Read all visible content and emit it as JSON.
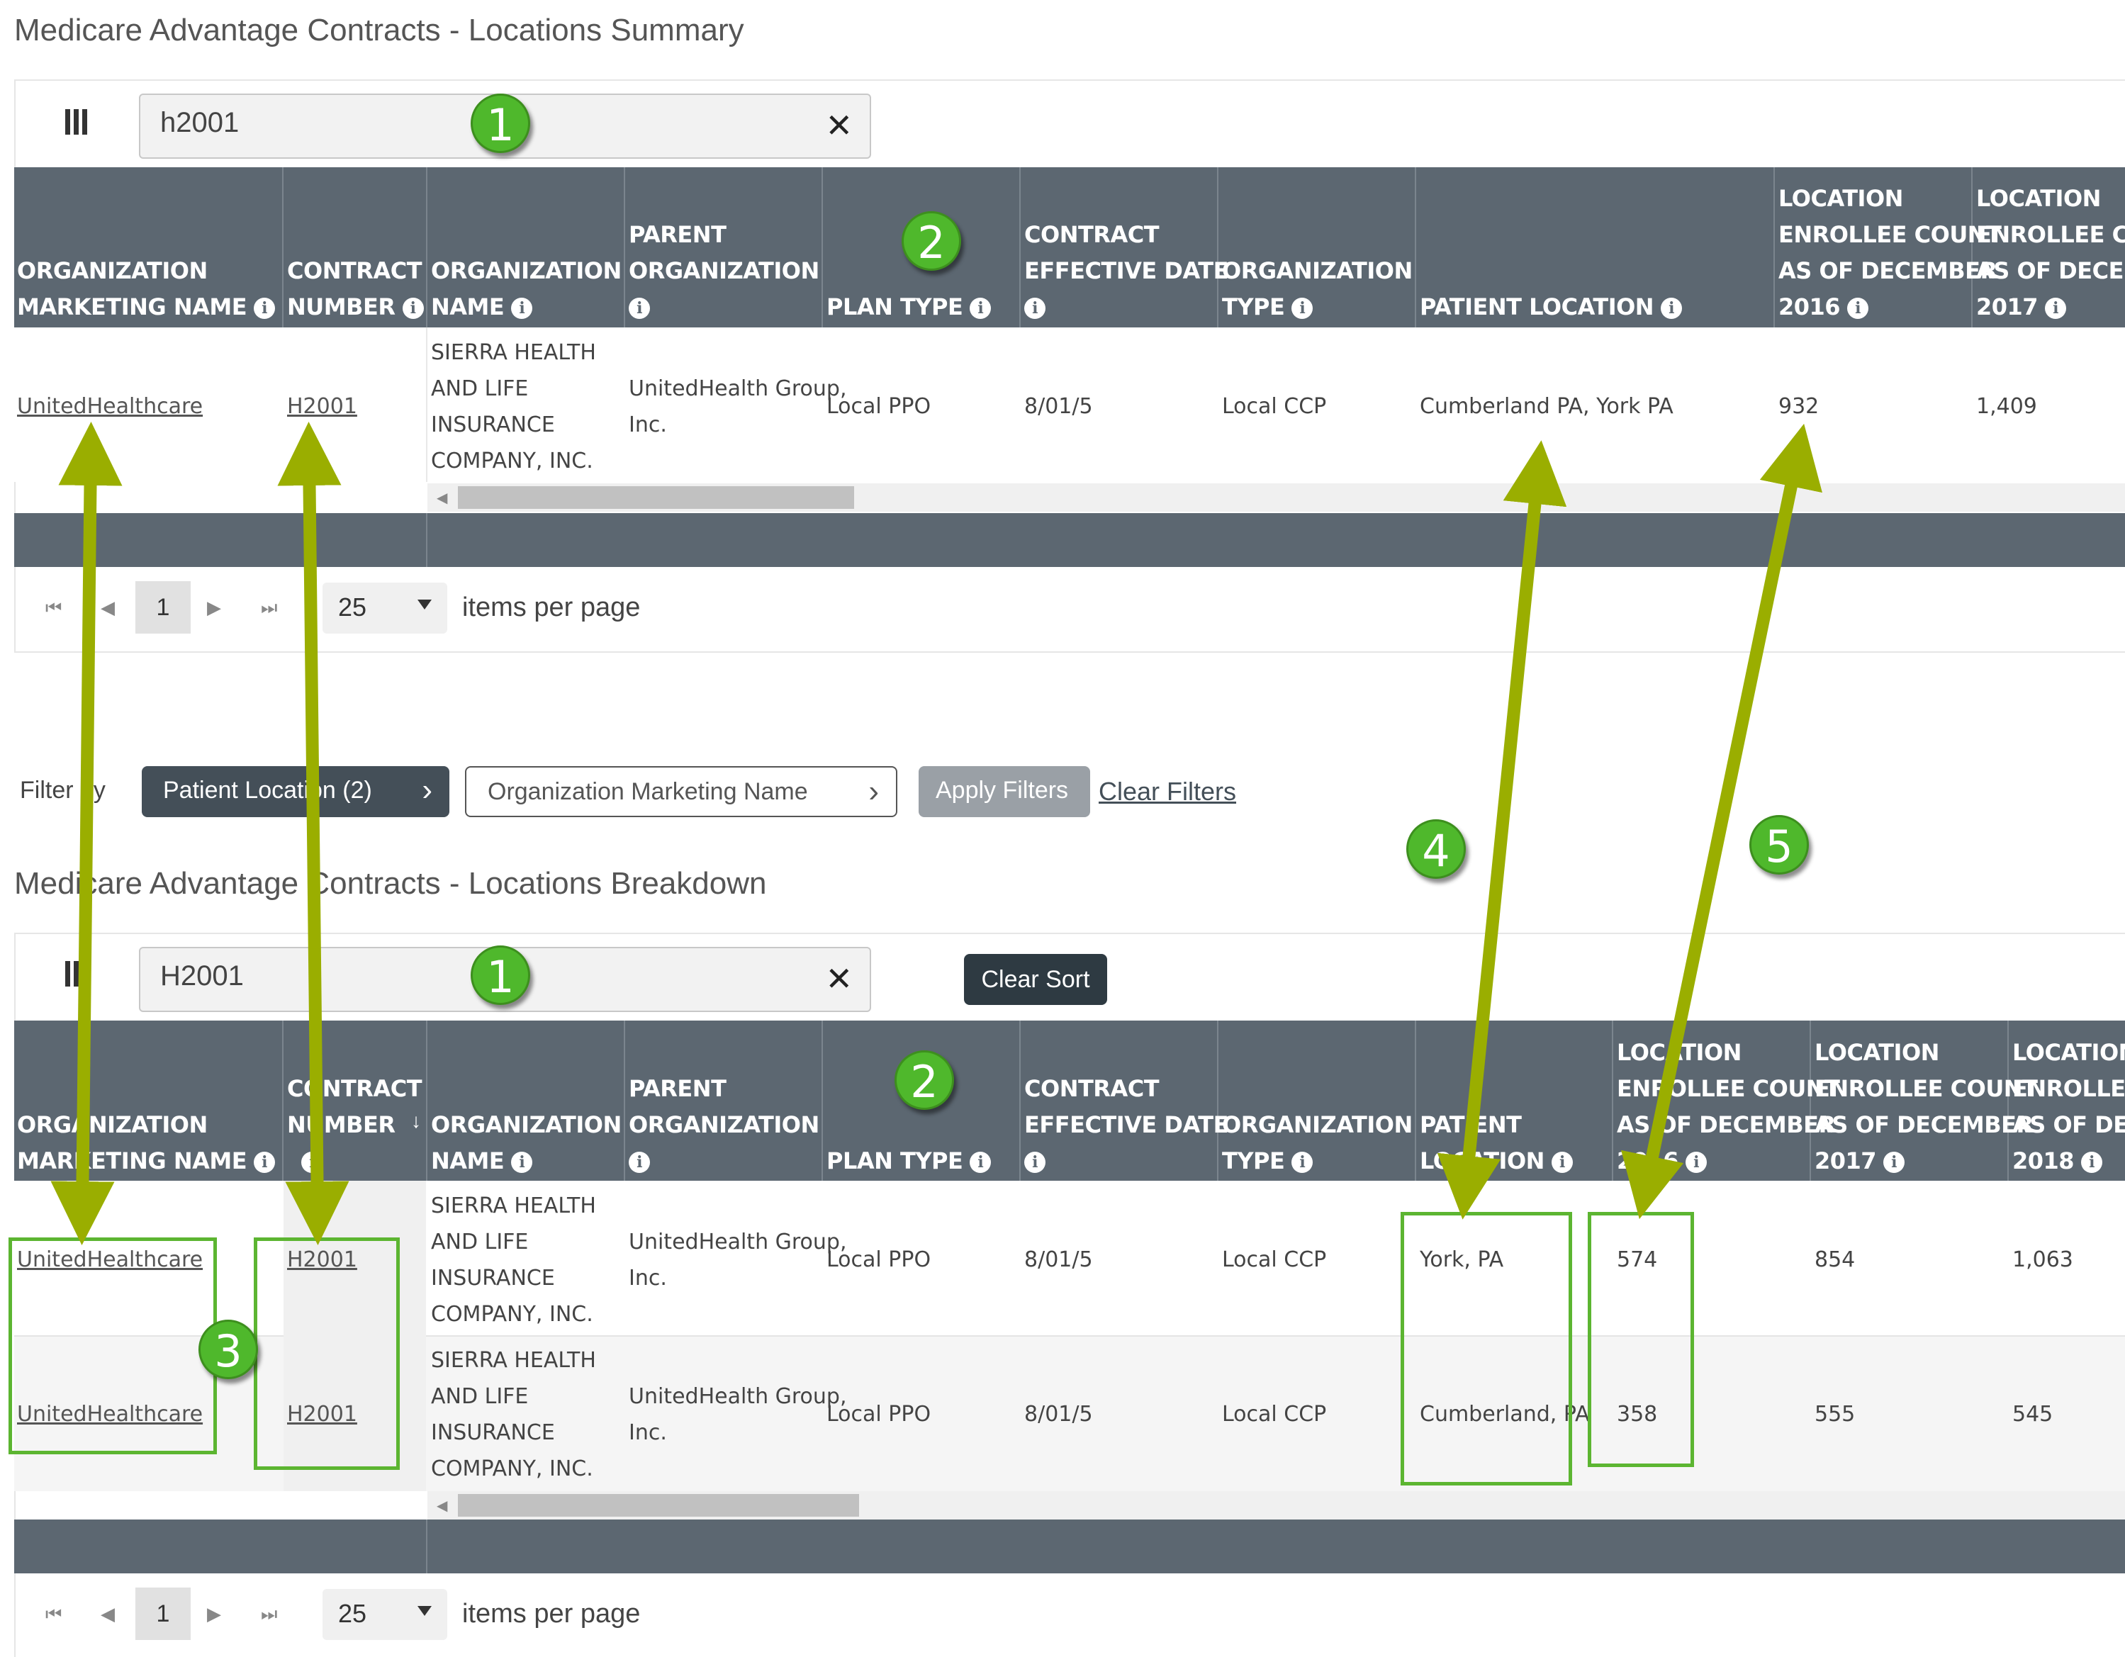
{
  "summary": {
    "title": "Medicare Advantage Contracts - Locations Summary",
    "search_value": "h2001",
    "headers": {
      "org_marketing_name": [
        "ORGANIZATION",
        "MARKETING NAME"
      ],
      "contract_number": [
        "CONTRACT",
        "NUMBER"
      ],
      "org_name": [
        "ORGANIZATION",
        "NAME"
      ],
      "parent_org": [
        "PARENT",
        "ORGANIZATION"
      ],
      "plan_type": [
        "PLAN TYPE"
      ],
      "contract_effective_date": [
        "CONTRACT",
        "EFFECTIVE DATE"
      ],
      "org_type": [
        "ORGANIZATION",
        "TYPE"
      ],
      "patient_location": [
        "PATIENT LOCATION"
      ],
      "loc_2016": [
        "LOCATION",
        "ENROLLEE COUNT",
        "AS OF DECEMBER",
        "2016"
      ],
      "loc_2017": [
        "LOCATION",
        "ENROLLEE COUI",
        "AS OF DECEMBI",
        "2017"
      ]
    },
    "row": {
      "org_marketing_name": "UnitedHealthcare",
      "contract_number": "H2001",
      "org_name": [
        "SIERRA HEALTH",
        "AND LIFE",
        "INSURANCE",
        "COMPANY, INC."
      ],
      "parent_org": [
        "UnitedHealth Group,",
        "Inc."
      ],
      "plan_type": "Local PPO",
      "contract_effective_date": "8/01/5",
      "org_type": "Local CCP",
      "patient_location": "Cumberland PA, York PA",
      "loc_2016": "932",
      "loc_2017": "1,409"
    },
    "pager": {
      "page": "1",
      "per_page": "25",
      "per_page_label": "items per page"
    }
  },
  "filters": {
    "label": "Filter by",
    "patient_location": "Patient Location (2)",
    "org_marketing_name": "Organization Marketing Name",
    "apply": "Apply Filters",
    "clear": "Clear Filters"
  },
  "breakdown": {
    "title": "Medicare Advantage Contracts - Locations Breakdown",
    "search_value": "H2001",
    "clear_sort": "Clear Sort",
    "headers": {
      "org_marketing_name": [
        "ORGANIZATION",
        "MARKETING NAME"
      ],
      "contract_number": [
        "CONTRACT",
        "NUMBER"
      ],
      "org_name": [
        "ORGANIZATION",
        "NAME"
      ],
      "parent_org": [
        "PARENT",
        "ORGANIZATION"
      ],
      "plan_type": [
        "PLAN TYPE"
      ],
      "contract_effective_date": [
        "CONTRACT",
        "EFFECTIVE DATE"
      ],
      "org_type": [
        "ORGANIZATION",
        "TYPE"
      ],
      "patient_location": [
        "PATIENT",
        "LOCATION"
      ],
      "loc_2016": [
        "LOCATION",
        "ENROLLEE COUNT",
        "AS OF DECEMBER",
        "2016"
      ],
      "loc_2017": [
        "LOCATION",
        "ENROLLEE COUNT",
        "AS OF DECEMBER",
        "2017"
      ],
      "loc_2018": [
        "LOCATION",
        "ENROLLEE C",
        "AS OF DECE",
        "2018"
      ]
    },
    "rows": [
      {
        "org_marketing_name": "UnitedHealthcare",
        "contract_number": "H2001",
        "org_name": [
          "SIERRA HEALTH",
          "AND LIFE",
          "INSURANCE",
          "COMPANY, INC."
        ],
        "parent_org": [
          "UnitedHealth Group,",
          "Inc."
        ],
        "plan_type": "Local PPO",
        "contract_effective_date": "8/01/5",
        "org_type": "Local CCP",
        "patient_location": "York, PA",
        "loc_2016": "574",
        "loc_2017": "854",
        "loc_2018": "1,063"
      },
      {
        "org_marketing_name": "UnitedHealthcare",
        "contract_number": "H2001",
        "org_name": [
          "SIERRA HEALTH",
          "AND LIFE",
          "INSURANCE",
          "COMPANY, INC."
        ],
        "parent_org": [
          "UnitedHealth Group,",
          "Inc."
        ],
        "plan_type": "Local PPO",
        "contract_effective_date": "8/01/5",
        "org_type": "Local CCP",
        "patient_location": "Cumberland, PA",
        "loc_2016": "358",
        "loc_2017": "555",
        "loc_2018": "545"
      }
    ],
    "pager": {
      "page": "1",
      "per_page": "25",
      "per_page_label": "items per page"
    }
  },
  "annotations": {
    "badges": [
      "1",
      "2",
      "1",
      "2",
      "3",
      "4",
      "5"
    ],
    "badge_color": "#4fb82c",
    "arrow_color": "#9aae00",
    "box_color": "#5cb531"
  }
}
